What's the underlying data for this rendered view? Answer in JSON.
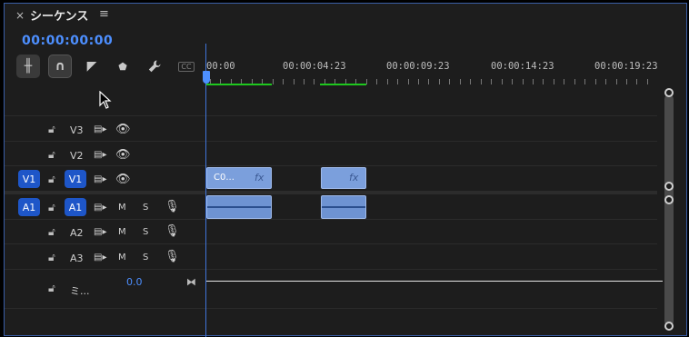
{
  "tab": {
    "title": "シーケンス",
    "close": "×",
    "menu": "≡"
  },
  "timecode": "00:00:00:00",
  "toolbar": {
    "tools": [
      {
        "name": "insert-snap",
        "icon": "╫"
      },
      {
        "name": "snap",
        "icon": "∩"
      },
      {
        "name": "linked-selection",
        "icon": "◤"
      },
      {
        "name": "add-marker",
        "icon": "⬟"
      },
      {
        "name": "settings",
        "icon": "🔧"
      },
      {
        "name": "captions",
        "icon": "CC"
      }
    ]
  },
  "ruler": {
    "labels": [
      "00:00",
      "00:00:04:23",
      "00:00:09:23",
      "00:00:14:23",
      "00:00:19:23"
    ]
  },
  "tracks": {
    "video": [
      {
        "name": "V3"
      },
      {
        "name": "V2"
      },
      {
        "name": "V1",
        "source": "V1"
      }
    ],
    "audio": [
      {
        "name": "A1",
        "source": "A1",
        "mute": "M",
        "solo": "S"
      },
      {
        "name": "A2",
        "mute": "M",
        "solo": "S"
      },
      {
        "name": "A3",
        "mute": "M",
        "solo": "S"
      }
    ],
    "mix": {
      "name": "ミ...",
      "value": "0.0"
    }
  },
  "clips": {
    "v1_first_label": "C0...",
    "fx": "fx"
  },
  "colors": {
    "accent": "#4d8fff",
    "clip": "#7b9fdc",
    "inout": "#1ec81e"
  }
}
